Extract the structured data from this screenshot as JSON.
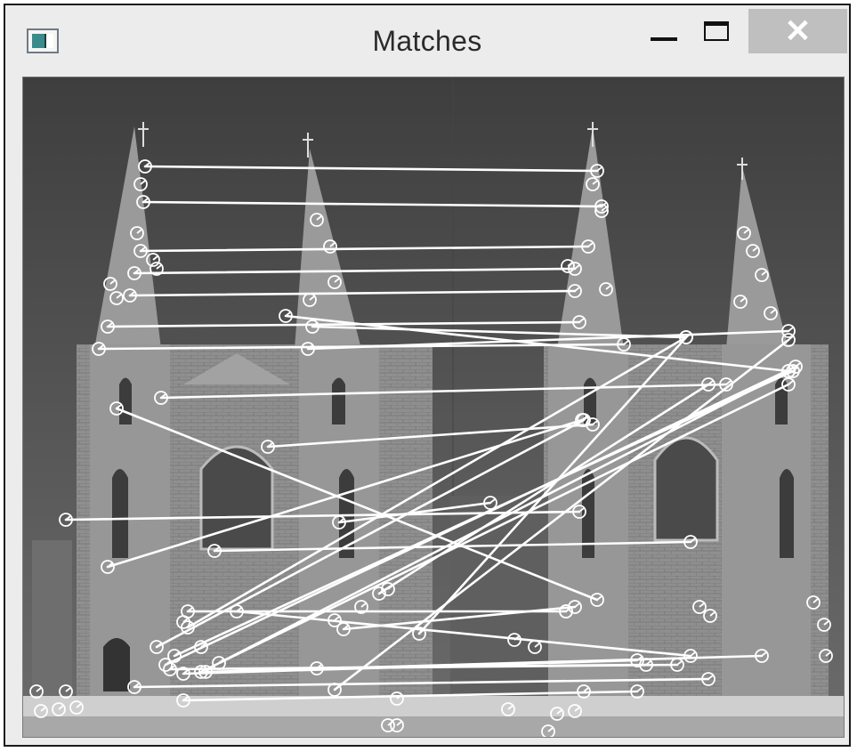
{
  "window": {
    "title": "Matches",
    "icon": "app-window-icon",
    "controls": {
      "minimize_icon": "minimize-icon",
      "maximize_icon": "maximize-icon",
      "close_label": "✕"
    }
  },
  "image": {
    "description_icon": "keypoint-matches-image",
    "colors": {
      "match_line": "#ffffff",
      "sky": "#5a5a5a",
      "stone": "#8a8a8a",
      "snow": "#d6d6d6"
    }
  }
}
